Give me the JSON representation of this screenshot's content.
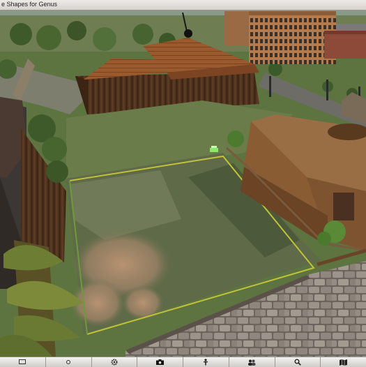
{
  "window": {
    "title": "e Shapes for Genus"
  },
  "scene": {
    "description_icons": [
      "grass-ground",
      "wooden-house",
      "brick-building",
      "cobblestone-path"
    ]
  },
  "toolbar": {
    "buttons": [
      {
        "icon": "chat-icon"
      },
      {
        "icon": "speak-icon"
      },
      {
        "icon": "gear-icon"
      },
      {
        "icon": "camera-icon"
      },
      {
        "icon": "person-icon"
      },
      {
        "icon": "people-icon"
      },
      {
        "icon": "search-icon"
      },
      {
        "icon": "map-icon"
      }
    ]
  }
}
